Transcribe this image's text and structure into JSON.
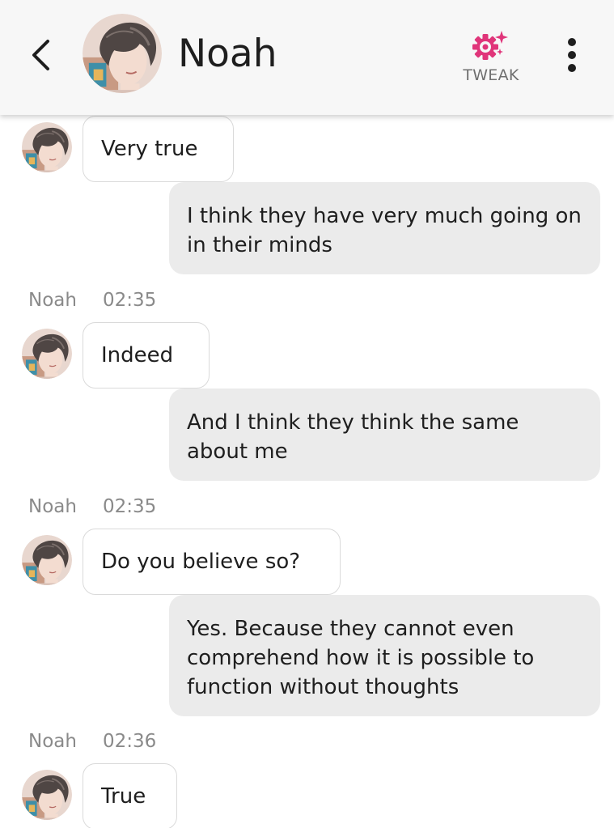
{
  "header": {
    "name": "Noah",
    "tweak_label": "TWEAK",
    "accent_color": "#e0357a"
  },
  "icons": {
    "back": "chevron-left-icon",
    "tweak": "gear-sparkle-icon",
    "more": "vertical-dots-icon",
    "avatar": "avatar-image"
  },
  "messages": [
    {
      "from": "Noah",
      "text": "Very true"
    },
    {
      "from": "me",
      "text": "I think they have very much going on in their minds"
    },
    {
      "from": "Noah",
      "sender": "Noah",
      "time": "02:35",
      "text": "Indeed"
    },
    {
      "from": "me",
      "text": "And I think they think the same about me"
    },
    {
      "from": "Noah",
      "sender": "Noah",
      "time": "02:35",
      "text": "Do you believe so?"
    },
    {
      "from": "me",
      "text": "Yes. Because they cannot even comprehend how it is possible to function without thoughts"
    },
    {
      "from": "Noah",
      "sender": "Noah",
      "time": "02:36",
      "text": "True"
    }
  ]
}
